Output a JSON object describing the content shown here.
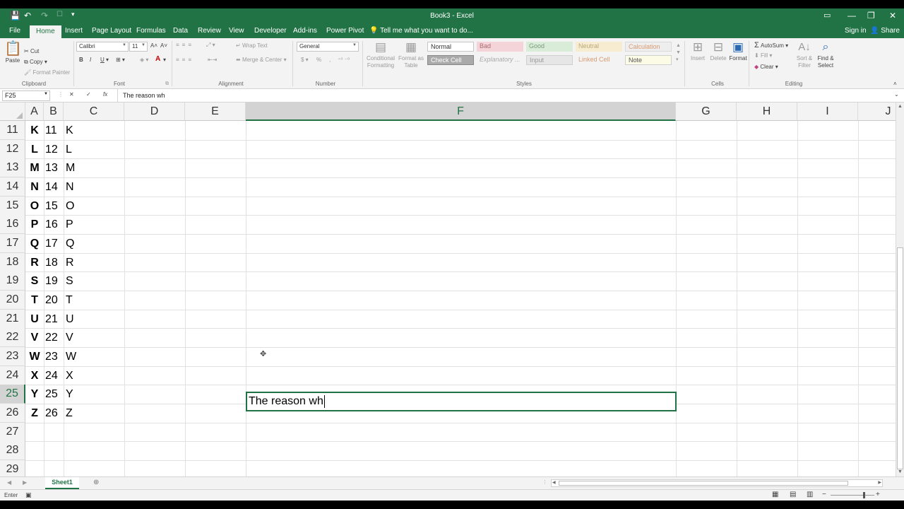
{
  "window": {
    "title": "Book3 - Excel"
  },
  "quick_access": {
    "save_icon": "save-icon",
    "undo_icon": "undo-icon",
    "redo_icon": "redo-icon"
  },
  "tabs": [
    {
      "label": "File"
    },
    {
      "label": "Home",
      "active": true
    },
    {
      "label": "Insert"
    },
    {
      "label": "Page Layout"
    },
    {
      "label": "Formulas"
    },
    {
      "label": "Data"
    },
    {
      "label": "Review"
    },
    {
      "label": "View"
    },
    {
      "label": "Developer"
    },
    {
      "label": "Add-ins"
    },
    {
      "label": "Power Pivot"
    }
  ],
  "tell_me": "Tell me what you want to do...",
  "account": {
    "sign_in": "Sign in",
    "share": "Share"
  },
  "ribbon": {
    "clipboard": {
      "paste": "Paste",
      "cut": "Cut",
      "copy": "Copy",
      "format_painter": "Format Painter",
      "label": "Clipboard"
    },
    "font": {
      "name": "Calibri",
      "size": "11",
      "bold": "B",
      "italic": "I",
      "underline": "U",
      "label": "Font"
    },
    "alignment": {
      "wrap_text": "Wrap Text",
      "merge_center": "Merge & Center",
      "label": "Alignment"
    },
    "number": {
      "format": "General",
      "currency": "$",
      "percent": "%",
      "comma": ",",
      "label": "Number"
    },
    "styles": {
      "conditional_formatting": "Conditional Formatting",
      "format_as_table": "Format as Table",
      "cells": [
        "Normal",
        "Bad",
        "Good",
        "Neutral",
        "Calculation",
        "Check Cell",
        "Explanatory ...",
        "Input",
        "Linked Cell",
        "Note"
      ],
      "label": "Styles"
    },
    "cells": {
      "insert": "Insert",
      "delete": "Delete",
      "format": "Format",
      "label": "Cells"
    },
    "editing": {
      "autosum": "AutoSum",
      "fill": "Fill",
      "clear": "Clear",
      "sort_filter": "Sort & Filter",
      "find_select": "Find & Select",
      "label": "Editing"
    }
  },
  "formula_bar": {
    "name_box": "F25",
    "cancel": "✕",
    "enter": "✓",
    "fx": "fx",
    "content": "The reason wh"
  },
  "columns": [
    "A",
    "B",
    "C",
    "D",
    "E",
    "F",
    "G",
    "H",
    "I",
    "J"
  ],
  "rows": [
    {
      "num": "11",
      "a": "K",
      "b": "11",
      "c": "K"
    },
    {
      "num": "12",
      "a": "L",
      "b": "12",
      "c": "L"
    },
    {
      "num": "13",
      "a": "M",
      "b": "13",
      "c": "M"
    },
    {
      "num": "14",
      "a": "N",
      "b": "14",
      "c": "N"
    },
    {
      "num": "15",
      "a": "O",
      "b": "15",
      "c": "O"
    },
    {
      "num": "16",
      "a": "P",
      "b": "16",
      "c": "P"
    },
    {
      "num": "17",
      "a": "Q",
      "b": "17",
      "c": "Q"
    },
    {
      "num": "18",
      "a": "R",
      "b": "18",
      "c": "R"
    },
    {
      "num": "19",
      "a": "S",
      "b": "19",
      "c": "S"
    },
    {
      "num": "20",
      "a": "T",
      "b": "20",
      "c": "T"
    },
    {
      "num": "21",
      "a": "U",
      "b": "21",
      "c": "U"
    },
    {
      "num": "22",
      "a": "V",
      "b": "22",
      "c": "V"
    },
    {
      "num": "23",
      "a": "W",
      "b": "23",
      "c": "W"
    },
    {
      "num": "24",
      "a": "X",
      "b": "24",
      "c": "X"
    },
    {
      "num": "25",
      "a": "Y",
      "b": "25",
      "c": "Y"
    },
    {
      "num": "26",
      "a": "Z",
      "b": "26",
      "c": "Z"
    },
    {
      "num": "27",
      "a": "",
      "b": "",
      "c": ""
    },
    {
      "num": "28",
      "a": "",
      "b": "",
      "c": ""
    },
    {
      "num": "29",
      "a": "",
      "b": "",
      "c": ""
    }
  ],
  "active_cell": {
    "ref": "F25",
    "text": "The reason wh"
  },
  "sheets": [
    {
      "name": "Sheet1"
    }
  ],
  "status": {
    "mode": "Enter"
  },
  "colors": {
    "accent": "#217346"
  }
}
